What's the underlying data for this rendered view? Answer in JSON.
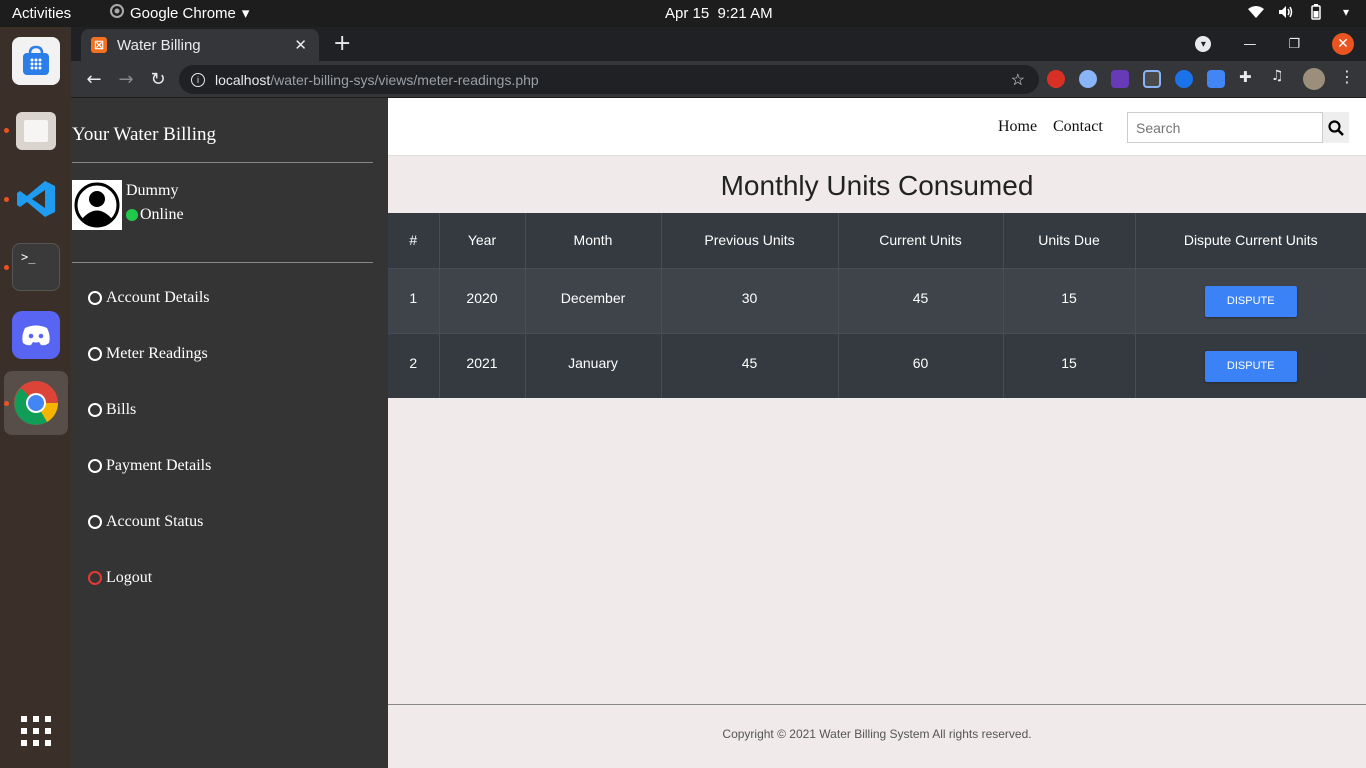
{
  "topbar": {
    "activities": "Activities",
    "app_name": "Google Chrome",
    "clock": "Apr 15  9:21 AM"
  },
  "browser": {
    "tab_title": "Water Billing",
    "url_host": "localhost",
    "url_path": "/water-billing-sys/views/meter-readings.php"
  },
  "sidebar": {
    "brand": "Your Water Billing",
    "user_name": "Dummy",
    "user_status": "Online",
    "menu": [
      {
        "label": "Account Details"
      },
      {
        "label": "Meter Readings"
      },
      {
        "label": "Bills"
      },
      {
        "label": "Payment Details"
      },
      {
        "label": "Account Status"
      },
      {
        "label": "Logout"
      }
    ]
  },
  "topnav": {
    "home": "Home",
    "contact": "Contact",
    "search_placeholder": "Search"
  },
  "main": {
    "title": "Monthly Units Consumed",
    "columns": [
      "#",
      "Year",
      "Month",
      "Previous Units",
      "Current Units",
      "Units Due",
      "Dispute Current Units"
    ],
    "rows": [
      {
        "num": "1",
        "year": "2020",
        "month": "December",
        "previous": "30",
        "current": "45",
        "due": "15",
        "action": "DISPUTE"
      },
      {
        "num": "2",
        "year": "2021",
        "month": "January",
        "previous": "45",
        "current": "60",
        "due": "15",
        "action": "DISPUTE"
      }
    ]
  },
  "footer": {
    "text": "Copyright © 2021 Water Billing System All rights reserved."
  },
  "colors": {
    "sidebar_bg": "#343434",
    "table_dark": "#343a40",
    "dispute_button": "#3b82f6",
    "online": "#20c94a"
  }
}
